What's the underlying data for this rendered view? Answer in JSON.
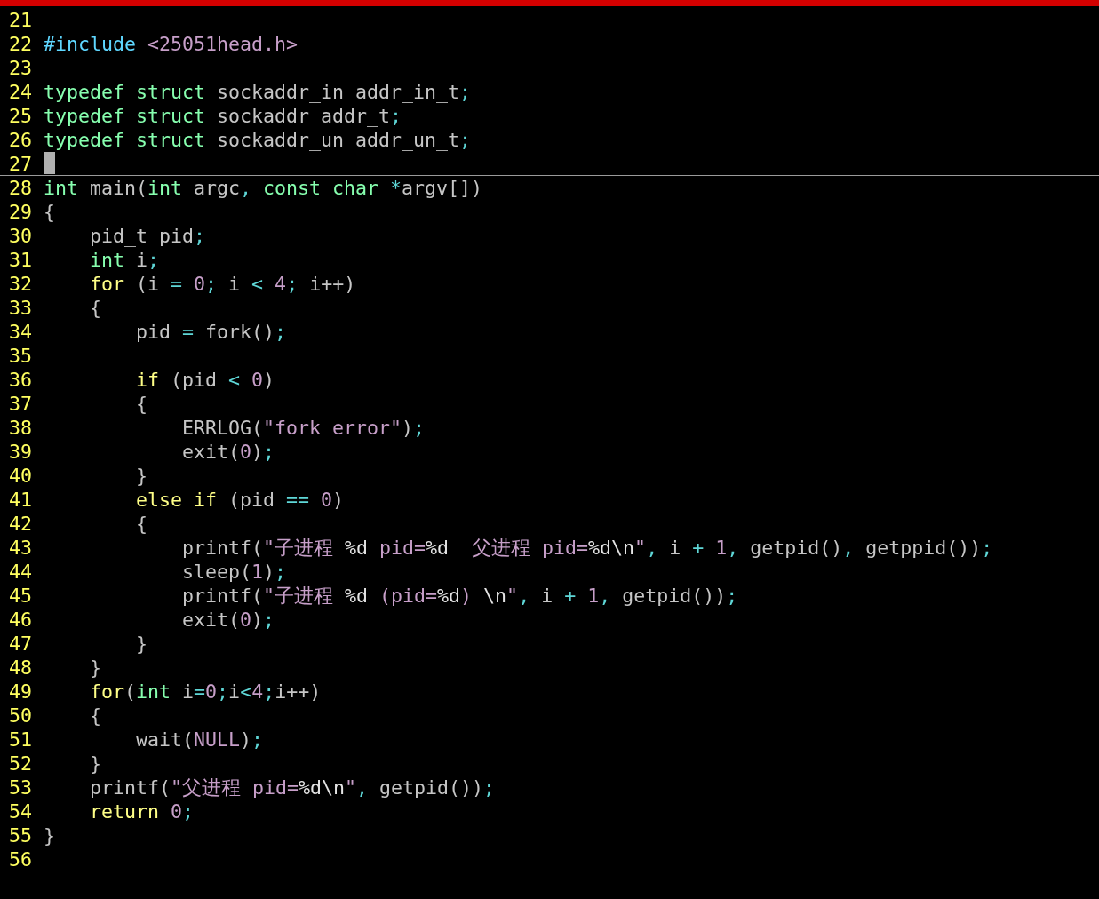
{
  "editor": {
    "lines": [
      {
        "number": "21"
      },
      {
        "number": "22",
        "tokens": [
          {
            "text": "#include",
            "kind": "preproc"
          },
          {
            "text": " <25051head.h>",
            "kind": "string"
          }
        ]
      },
      {
        "number": "23"
      },
      {
        "number": "24",
        "tokens": [
          {
            "text": "typedef struct",
            "kind": "type"
          },
          {
            "text": " sockaddr_in addr_in_t",
            "kind": "plain"
          },
          {
            "text": ";",
            "kind": "op"
          }
        ]
      },
      {
        "number": "25",
        "tokens": [
          {
            "text": "typedef struct",
            "kind": "type"
          },
          {
            "text": " sockaddr addr_t",
            "kind": "plain"
          },
          {
            "text": ";",
            "kind": "op"
          }
        ]
      },
      {
        "number": "26",
        "tokens": [
          {
            "text": "typedef struct",
            "kind": "type"
          },
          {
            "text": " sockaddr_un addr_un_t",
            "kind": "plain"
          },
          {
            "text": ";",
            "kind": "op"
          }
        ]
      },
      {
        "number": "27",
        "cursor": true
      },
      {
        "number": "28",
        "tokens": [
          {
            "text": "int",
            "kind": "type"
          },
          {
            "text": " main(",
            "kind": "plain"
          },
          {
            "text": "int",
            "kind": "type"
          },
          {
            "text": " argc",
            "kind": "plain"
          },
          {
            "text": ",",
            "kind": "op"
          },
          {
            "text": " const char",
            "kind": "type"
          },
          {
            "text": " *",
            "kind": "op"
          },
          {
            "text": "argv[])",
            "kind": "plain"
          }
        ]
      },
      {
        "number": "29",
        "tokens": [
          {
            "text": "{",
            "kind": "plain"
          }
        ]
      },
      {
        "number": "30",
        "tokens": [
          {
            "text": "    pid_t pid",
            "kind": "plain"
          },
          {
            "text": ";",
            "kind": "op"
          }
        ]
      },
      {
        "number": "31",
        "tokens": [
          {
            "text": "    int",
            "kind": "type"
          },
          {
            "text": " i",
            "kind": "plain"
          },
          {
            "text": ";",
            "kind": "op"
          }
        ]
      },
      {
        "number": "32",
        "tokens": [
          {
            "text": "    for",
            "kind": "statement"
          },
          {
            "text": " (i ",
            "kind": "plain"
          },
          {
            "text": "=",
            "kind": "op"
          },
          {
            "text": " 0",
            "kind": "number"
          },
          {
            "text": ";",
            "kind": "op"
          },
          {
            "text": " i ",
            "kind": "plain"
          },
          {
            "text": "<",
            "kind": "op"
          },
          {
            "text": " 4",
            "kind": "number"
          },
          {
            "text": ";",
            "kind": "op"
          },
          {
            "text": " i++)",
            "kind": "plain"
          }
        ]
      },
      {
        "number": "33",
        "tokens": [
          {
            "text": "    {",
            "kind": "plain"
          }
        ]
      },
      {
        "number": "34",
        "tokens": [
          {
            "text": "        pid ",
            "kind": "plain"
          },
          {
            "text": "=",
            "kind": "op"
          },
          {
            "text": " fork()",
            "kind": "plain"
          },
          {
            "text": ";",
            "kind": "op"
          }
        ]
      },
      {
        "number": "35"
      },
      {
        "number": "36",
        "tokens": [
          {
            "text": "        if",
            "kind": "statement"
          },
          {
            "text": " (pid ",
            "kind": "plain"
          },
          {
            "text": "<",
            "kind": "op"
          },
          {
            "text": " 0",
            "kind": "number"
          },
          {
            "text": ")",
            "kind": "plain"
          }
        ]
      },
      {
        "number": "37",
        "tokens": [
          {
            "text": "        {",
            "kind": "plain"
          }
        ]
      },
      {
        "number": "38",
        "tokens": [
          {
            "text": "            ERRLOG(",
            "kind": "plain"
          },
          {
            "text": "\"fork error\"",
            "kind": "string"
          },
          {
            "text": ")",
            "kind": "plain"
          },
          {
            "text": ";",
            "kind": "op"
          }
        ]
      },
      {
        "number": "39",
        "tokens": [
          {
            "text": "            exit(",
            "kind": "plain"
          },
          {
            "text": "0",
            "kind": "number"
          },
          {
            "text": ")",
            "kind": "plain"
          },
          {
            "text": ";",
            "kind": "op"
          }
        ]
      },
      {
        "number": "40",
        "tokens": [
          {
            "text": "        }",
            "kind": "plain"
          }
        ]
      },
      {
        "number": "41",
        "tokens": [
          {
            "text": "        else if",
            "kind": "statement"
          },
          {
            "text": " (pid ",
            "kind": "plain"
          },
          {
            "text": "==",
            "kind": "op"
          },
          {
            "text": " 0",
            "kind": "number"
          },
          {
            "text": ")",
            "kind": "plain"
          }
        ]
      },
      {
        "number": "42",
        "tokens": [
          {
            "text": "        {",
            "kind": "plain"
          }
        ]
      },
      {
        "number": "43",
        "tokens": [
          {
            "text": "            printf(",
            "kind": "plain"
          },
          {
            "text": "\"子进程 ",
            "kind": "string"
          },
          {
            "text": "%d",
            "kind": "special"
          },
          {
            "text": " pid=",
            "kind": "string"
          },
          {
            "text": "%d",
            "kind": "special"
          },
          {
            "text": "  父进程 pid=",
            "kind": "string"
          },
          {
            "text": "%d\\n",
            "kind": "special"
          },
          {
            "text": "\"",
            "kind": "string"
          },
          {
            "text": ",",
            "kind": "op"
          },
          {
            "text": " i ",
            "kind": "plain"
          },
          {
            "text": "+",
            "kind": "op"
          },
          {
            "text": " 1",
            "kind": "number"
          },
          {
            "text": ",",
            "kind": "op"
          },
          {
            "text": " getpid()",
            "kind": "plain"
          },
          {
            "text": ",",
            "kind": "op"
          },
          {
            "text": " getppid())",
            "kind": "plain"
          },
          {
            "text": ";",
            "kind": "op"
          }
        ]
      },
      {
        "number": "44",
        "tokens": [
          {
            "text": "            sleep(",
            "kind": "plain"
          },
          {
            "text": "1",
            "kind": "number"
          },
          {
            "text": ")",
            "kind": "plain"
          },
          {
            "text": ";",
            "kind": "op"
          }
        ]
      },
      {
        "number": "45",
        "tokens": [
          {
            "text": "            printf(",
            "kind": "plain"
          },
          {
            "text": "\"子进程 ",
            "kind": "string"
          },
          {
            "text": "%d",
            "kind": "special"
          },
          {
            "text": " (pid=",
            "kind": "string"
          },
          {
            "text": "%d",
            "kind": "special"
          },
          {
            "text": ") ",
            "kind": "string"
          },
          {
            "text": "\\n",
            "kind": "special"
          },
          {
            "text": "\"",
            "kind": "string"
          },
          {
            "text": ",",
            "kind": "op"
          },
          {
            "text": " i ",
            "kind": "plain"
          },
          {
            "text": "+",
            "kind": "op"
          },
          {
            "text": " 1",
            "kind": "number"
          },
          {
            "text": ",",
            "kind": "op"
          },
          {
            "text": " getpid())",
            "kind": "plain"
          },
          {
            "text": ";",
            "kind": "op"
          }
        ]
      },
      {
        "number": "46",
        "tokens": [
          {
            "text": "            exit(",
            "kind": "plain"
          },
          {
            "text": "0",
            "kind": "number"
          },
          {
            "text": ")",
            "kind": "plain"
          },
          {
            "text": ";",
            "kind": "op"
          }
        ]
      },
      {
        "number": "47",
        "tokens": [
          {
            "text": "        }",
            "kind": "plain"
          }
        ]
      },
      {
        "number": "48",
        "tokens": [
          {
            "text": "    }",
            "kind": "plain"
          }
        ]
      },
      {
        "number": "49",
        "tokens": [
          {
            "text": "    for",
            "kind": "statement"
          },
          {
            "text": "(",
            "kind": "plain"
          },
          {
            "text": "int",
            "kind": "type"
          },
          {
            "text": " i",
            "kind": "plain"
          },
          {
            "text": "=",
            "kind": "op"
          },
          {
            "text": "0",
            "kind": "number"
          },
          {
            "text": ";",
            "kind": "op"
          },
          {
            "text": "i",
            "kind": "plain"
          },
          {
            "text": "<",
            "kind": "op"
          },
          {
            "text": "4",
            "kind": "number"
          },
          {
            "text": ";",
            "kind": "op"
          },
          {
            "text": "i++)",
            "kind": "plain"
          }
        ]
      },
      {
        "number": "50",
        "tokens": [
          {
            "text": "    {",
            "kind": "plain"
          }
        ]
      },
      {
        "number": "51",
        "tokens": [
          {
            "text": "        wait(",
            "kind": "plain"
          },
          {
            "text": "NULL",
            "kind": "number"
          },
          {
            "text": ")",
            "kind": "plain"
          },
          {
            "text": ";",
            "kind": "op"
          }
        ]
      },
      {
        "number": "52",
        "tokens": [
          {
            "text": "    }",
            "kind": "plain"
          }
        ]
      },
      {
        "number": "53",
        "tokens": [
          {
            "text": "    printf(",
            "kind": "plain"
          },
          {
            "text": "\"父进程 pid=",
            "kind": "string"
          },
          {
            "text": "%d\\n",
            "kind": "special"
          },
          {
            "text": "\"",
            "kind": "string"
          },
          {
            "text": ",",
            "kind": "op"
          },
          {
            "text": " getpid())",
            "kind": "plain"
          },
          {
            "text": ";",
            "kind": "op"
          }
        ]
      },
      {
        "number": "54",
        "tokens": [
          {
            "text": "    return",
            "kind": "statement"
          },
          {
            "text": " 0",
            "kind": "number"
          },
          {
            "text": ";",
            "kind": "op"
          }
        ]
      },
      {
        "number": "55",
        "tokens": [
          {
            "text": "}",
            "kind": "plain"
          }
        ]
      },
      {
        "number": "56"
      }
    ]
  }
}
